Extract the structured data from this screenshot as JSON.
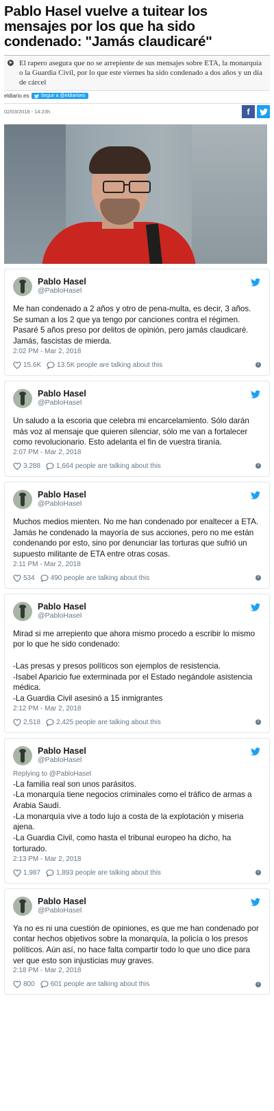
{
  "article": {
    "headline": "Pablo Hasel vuelve a tuitear los mensajes por los que ha sido condenado: \"Jamás claudicaré\"",
    "summary": "El rapero asegura que no se arrepiente de sus mensajes sobre ETA, la monarquía o la Guardia Civil, por lo que este viernes ha sido condenado a dos años y un día de cárcel",
    "source": "eldiario.es",
    "follow_label": "Seguir a @eldiarioes",
    "date": "02/03/2018 - 14:23h",
    "share_facebook": "f",
    "share_twitter": "t"
  },
  "tweets": [
    {
      "name": "Pablo Hasel",
      "handle": "@PabloHasel",
      "reply_to": "",
      "text": "Me han condenado a 2 años y otro de pena-multa, es decir, 3 años. Se suman a los 2 que ya tengo por canciones contra el régimen. Pasaré 5 años preso por delitos de opinión, pero jamás claudicaré. Jamás, fascistas de mierda.",
      "time": "2:02 PM - Mar 2, 2018",
      "likes": "15.6K",
      "talking": "13.5K people are talking about this"
    },
    {
      "name": "Pablo Hasel",
      "handle": "@PabloHasel",
      "reply_to": "",
      "text": "Un saludo a la escoria que celebra mi encarcelamiento. Sólo darán más voz al mensaje que quieren silenciar, sólo me van a fortalecer como revolucionario. Esto adelanta el fin de vuestra tiranía.",
      "time": "2:07 PM - Mar 2, 2018",
      "likes": "3,288",
      "talking": "1,664 people are talking about this"
    },
    {
      "name": "Pablo Hasel",
      "handle": "@PabloHasel",
      "reply_to": "",
      "text": "Muchos medios mienten. No me han condenado por enaltecer a ETA. Jamás he condenado la mayoría de sus acciones, pero no me están condenando por esto, sino por denunciar las torturas que sufrió un supuesto militante de ETA entre otras cosas.",
      "time": "2:11 PM - Mar 2, 2018",
      "likes": "534",
      "talking": "490 people are talking about this"
    },
    {
      "name": "Pablo Hasel",
      "handle": "@PabloHasel",
      "reply_to": "",
      "text": "Mirad si me arrepiento que ahora mismo procedo a escribir lo mismo por lo que he sido condenado:\n\n-Las presas y presos políticos son ejemplos de resistencia.\n-Isabel Aparicio fue exterminada por el Estado negándole asistencia médica.\n-La Guardia Civil asesinó a 15 inmigrantes",
      "time": "2:12 PM - Mar 2, 2018",
      "likes": "2,518",
      "talking": "2,425 people are talking about this"
    },
    {
      "name": "Pablo Hasel",
      "handle": "@PabloHasel",
      "reply_to": "Replying to @PabloHasel",
      "text": "-La familia real son unos parásitos.\n-La monarquía tiene negocios criminales como el tráfico de armas a Arabia Saudí.\n-La monarquía vive a todo lujo a costa de la explotación y miseria ajena.\n-La Guardia Civil, como hasta el tribunal europeo ha dicho, ha torturado.",
      "time": "2:13 PM - Mar 2, 2018",
      "likes": "1,987",
      "talking": "1,893 people are talking about this"
    },
    {
      "name": "Pablo Hasel",
      "handle": "@PabloHasel",
      "reply_to": "",
      "text": "Ya no es ni una cuestión de opiniones, es que me han condenado por contar hechos objetivos sobre la monarquía, la policía o los presos políticos. Aún así, no hace falta compartir todo lo que uno dice para ver que esto son injusticias muy graves.",
      "time": "2:18 PM - Mar 2, 2018",
      "likes": "800",
      "talking": "601 people are talking about this"
    }
  ],
  "colors": {
    "twitter_blue": "#1da1f2",
    "facebook_blue": "#3b5998",
    "muted_text": "#657786"
  }
}
